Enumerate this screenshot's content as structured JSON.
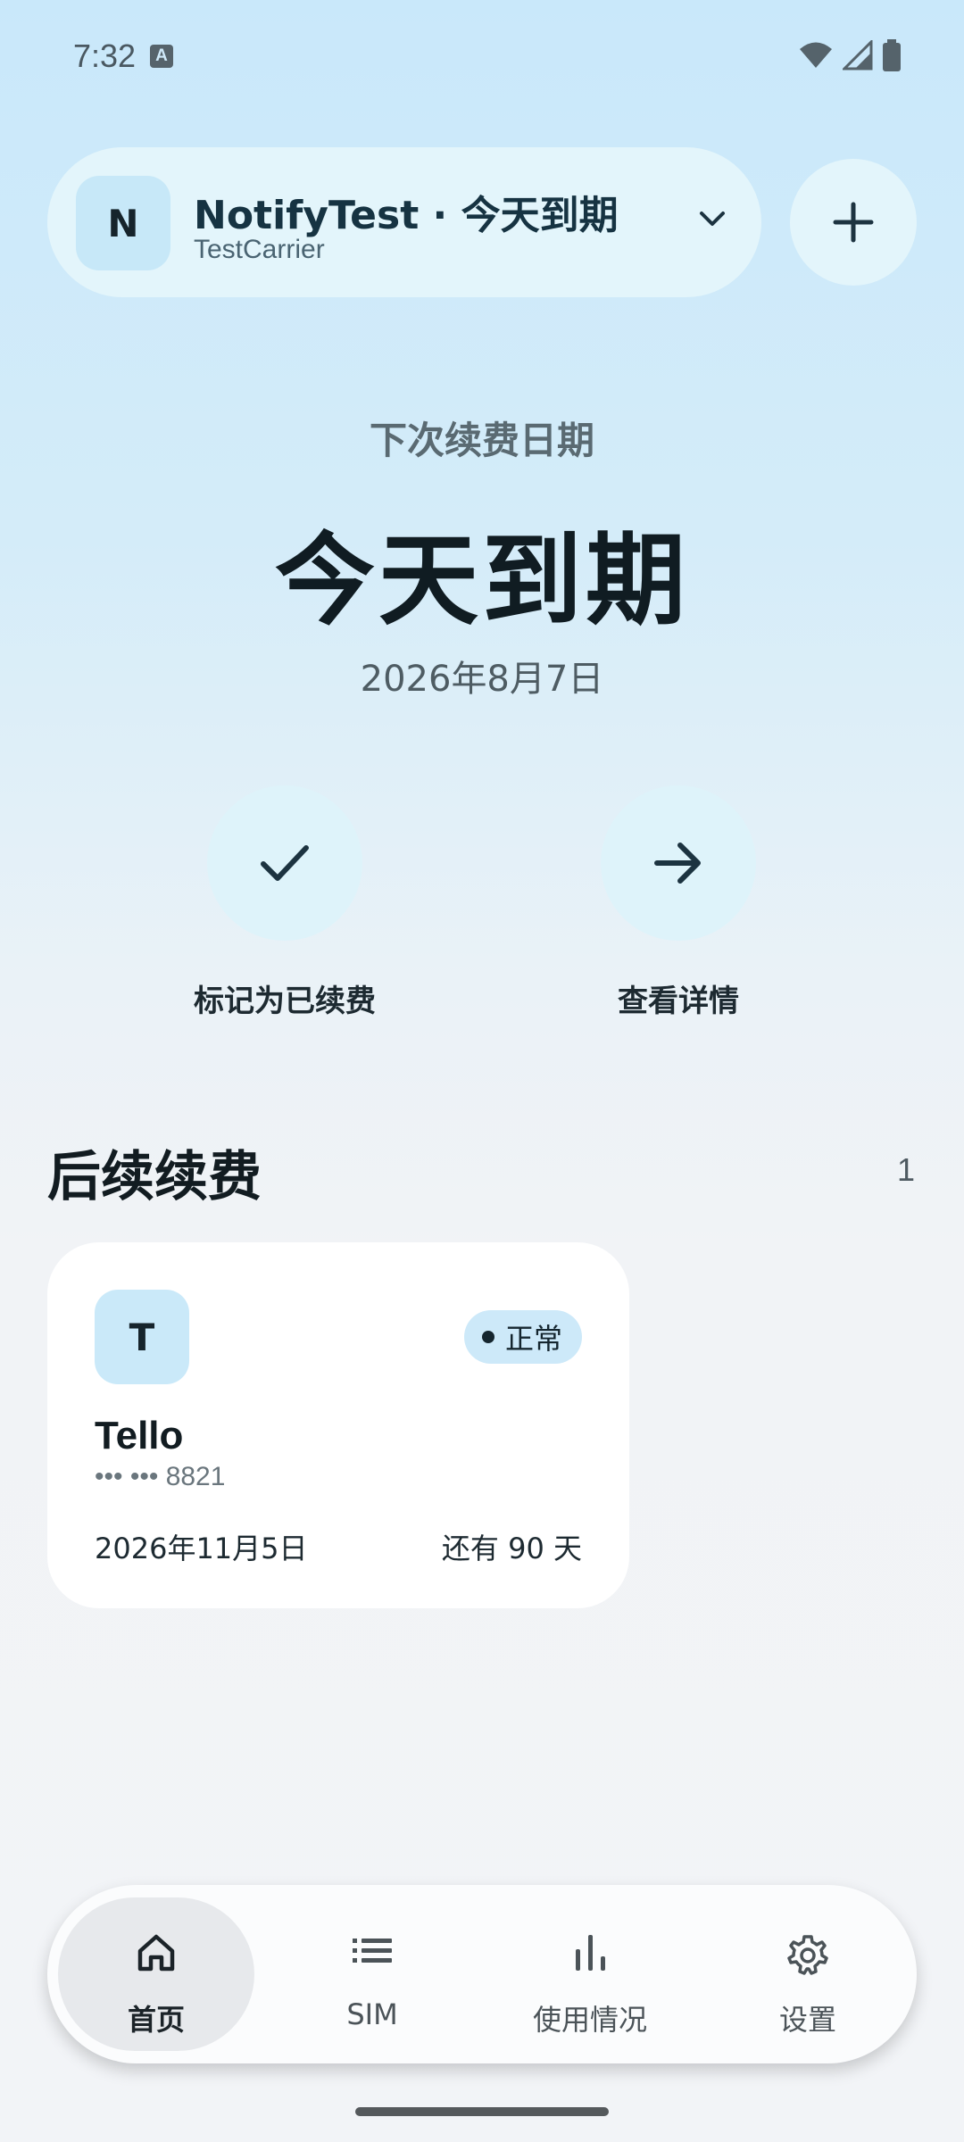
{
  "status_bar": {
    "time": "7:32",
    "notification_icon": "A",
    "icons": [
      "wifi-icon",
      "signal-icon",
      "battery-icon"
    ]
  },
  "account": {
    "avatar_letter": "N",
    "title": "NotifyTest · 今天到期",
    "carrier": "TestCarrier",
    "chevron_icon": "chevron-down-icon",
    "add_icon": "plus-icon"
  },
  "hero": {
    "label": "下次续费日期",
    "title": "今天到期",
    "date": "2026年8月7日"
  },
  "actions": {
    "mark_renewed": "标记为已续费",
    "view_details": "查看详情"
  },
  "upcoming": {
    "title": "后续续费",
    "count": "1",
    "items": [
      {
        "avatar_letter": "T",
        "status": "正常",
        "name": "Tello",
        "number": "••• ••• 8821",
        "date": "2026年11月5日",
        "remaining": "还有 90 天"
      }
    ]
  },
  "nav": {
    "home": "首页",
    "sim": "SIM",
    "usage": "使用情况",
    "settings": "设置"
  },
  "colors": {
    "accent": "#163342",
    "pill_bg": "#e3f5fb",
    "badge_bg": "#cde9f9"
  }
}
